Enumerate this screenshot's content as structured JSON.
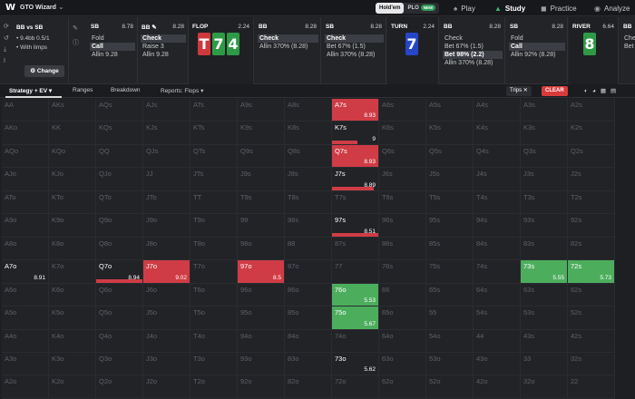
{
  "app": {
    "logo": "W",
    "brand": "GTO Wizard",
    "mode": [
      "Hold'em",
      "PLO"
    ],
    "mode_badge": "NEW",
    "nav": [
      {
        "label": "Play",
        "icon": "spade-icon"
      },
      {
        "label": "Study",
        "icon": "graduation-cap-icon"
      },
      {
        "label": "Practice",
        "icon": "gamepad-icon"
      },
      {
        "label": "Analyze",
        "icon": "robot-icon"
      }
    ]
  },
  "game": {
    "title": "BB vs SB",
    "stack_line": "• 9.4bb 0.5/1",
    "limps_line": "• With limps",
    "change_label": "Change"
  },
  "actions": [
    {
      "pos": "SB",
      "stack": "8.78",
      "items": [
        "Fold",
        "Call",
        "Allin 9.28"
      ],
      "selected": 1
    },
    {
      "pos": "BB",
      "stack": "8.28",
      "items": [
        "Check",
        "Raise 3",
        "Allin 9.28"
      ],
      "selected": 0
    },
    {
      "pos": "FLOP",
      "stack": "2.24",
      "board": [
        "T",
        "7",
        "4"
      ],
      "colors": [
        "#d0383c",
        "#2f9a46",
        "#2f9a46"
      ]
    },
    {
      "pos": "BB",
      "stack": "8.28",
      "items": [
        "Check",
        "Allin 370% (8.28)"
      ],
      "selected": 0
    },
    {
      "pos": "SB",
      "stack": "8.28",
      "items": [
        "Check",
        "Bet 67% (1.5)",
        "Allin 370% (8.28)"
      ],
      "selected": 0
    },
    {
      "pos": "TURN",
      "stack": "2.24",
      "board": [
        "7"
      ],
      "colors": [
        "#2546c8"
      ]
    },
    {
      "pos": "BB",
      "stack": "8.28",
      "items": [
        "Check",
        "Bet 67% (1.5)",
        "Bet 98% (2.2)",
        "Allin 370% (8.28)"
      ],
      "selected": 2
    },
    {
      "pos": "SB",
      "stack": "8.28",
      "items": [
        "Fold",
        "Call",
        "Allin 92% (8.28)"
      ],
      "selected": 1
    },
    {
      "pos": "RIVER",
      "stack": "6.64",
      "board": [
        "8"
      ],
      "colors": [
        "#2f9a46"
      ]
    },
    {
      "pos": "BB",
      "stack": "",
      "items": [
        "Chec",
        "Bet"
      ],
      "selected": -1
    }
  ],
  "subnav": {
    "tabs": [
      "Strategy + EV",
      "Ranges",
      "Breakdown",
      "Reports: Flops"
    ],
    "trips": "Trips",
    "clear": "CLEAR"
  },
  "grid": {
    "rows": [
      [
        "AA",
        "AKs",
        "AQs",
        "AJs",
        "ATs",
        "A9s",
        "A8s",
        "A7s",
        "A6s",
        "A5s",
        "A4s",
        "A3s",
        "A2s"
      ],
      [
        "AKo",
        "KK",
        "KQs",
        "KJs",
        "KTs",
        "K9s",
        "K8s",
        "K7s",
        "K6s",
        "K5s",
        "K4s",
        "K3s",
        "K2s"
      ],
      [
        "AQo",
        "KQo",
        "QQ",
        "QJs",
        "QTs",
        "Q9s",
        "Q8s",
        "Q7s",
        "Q6s",
        "Q5s",
        "Q4s",
        "Q3s",
        "Q2s"
      ],
      [
        "AJo",
        "KJo",
        "QJo",
        "JJ",
        "JTs",
        "J9s",
        "J8s",
        "J7s",
        "J6s",
        "J5s",
        "J4s",
        "J3s",
        "J2s"
      ],
      [
        "ATo",
        "KTo",
        "QTo",
        "JTo",
        "TT",
        "T9s",
        "T8s",
        "T7s",
        "T6s",
        "T5s",
        "T4s",
        "T3s",
        "T2s"
      ],
      [
        "A9o",
        "K9o",
        "Q9o",
        "J9o",
        "T9o",
        "99",
        "98s",
        "97s",
        "96s",
        "95s",
        "94s",
        "93s",
        "92s"
      ],
      [
        "A8o",
        "K8o",
        "Q8o",
        "J8o",
        "T8o",
        "98o",
        "88",
        "87s",
        "86s",
        "85s",
        "84s",
        "83s",
        "82s"
      ],
      [
        "A7o",
        "K7o",
        "Q7o",
        "J7o",
        "T7o",
        "97o",
        "87o",
        "77",
        "76s",
        "75s",
        "74s",
        "73s",
        "72s"
      ],
      [
        "A6o",
        "K6o",
        "Q6o",
        "J6o",
        "T6o",
        "96o",
        "86o",
        "76o",
        "66",
        "65s",
        "64s",
        "63s",
        "62s"
      ],
      [
        "A5o",
        "K5o",
        "Q5o",
        "J5o",
        "T5o",
        "95o",
        "85o",
        "75o",
        "65o",
        "55",
        "54s",
        "53s",
        "52s"
      ],
      [
        "A4o",
        "K4o",
        "Q4o",
        "J4o",
        "T4o",
        "94o",
        "84o",
        "74o",
        "64o",
        "54o",
        "44",
        "43s",
        "42s"
      ],
      [
        "A3o",
        "K3o",
        "Q3o",
        "J3o",
        "T3o",
        "93o",
        "83o",
        "73o",
        "63o",
        "53o",
        "43o",
        "33",
        "32s"
      ],
      [
        "A2o",
        "K2o",
        "Q2o",
        "J2o",
        "T2o",
        "92o",
        "82o",
        "72o",
        "62o",
        "52o",
        "42o",
        "32o",
        "22"
      ]
    ],
    "highlights": [
      {
        "r": 0,
        "c": 7,
        "type": "red",
        "fill": 1,
        "ev": "8.93"
      },
      {
        "r": 1,
        "c": 7,
        "type": "bar",
        "fill": 0.55,
        "ev": "9"
      },
      {
        "r": 2,
        "c": 7,
        "type": "red",
        "fill": 1,
        "ev": "8.93"
      },
      {
        "r": 3,
        "c": 7,
        "type": "bar",
        "fill": 0.9,
        "ev": "8.89"
      },
      {
        "r": 5,
        "c": 7,
        "type": "bar",
        "fill": 1,
        "ev": "8.51"
      },
      {
        "r": 7,
        "c": 0,
        "type": "plain",
        "fill": 0,
        "ev": "8.91"
      },
      {
        "r": 7,
        "c": 2,
        "type": "bar",
        "fill": 1,
        "ev": "8.94"
      },
      {
        "r": 7,
        "c": 3,
        "type": "red",
        "fill": 1,
        "ev": "9.02"
      },
      {
        "r": 7,
        "c": 5,
        "type": "red",
        "fill": 1,
        "ev": "8.5"
      },
      {
        "r": 7,
        "c": 11,
        "type": "green",
        "fill": 1,
        "ev": "5.55"
      },
      {
        "r": 7,
        "c": 12,
        "type": "green",
        "fill": 1,
        "ev": "5.73"
      },
      {
        "r": 8,
        "c": 7,
        "type": "green",
        "fill": 1,
        "ev": "5.53"
      },
      {
        "r": 9,
        "c": 7,
        "type": "green",
        "fill": 1,
        "ev": "5.67"
      },
      {
        "r": 11,
        "c": 7,
        "type": "plain",
        "fill": 0,
        "ev": "5.62"
      }
    ]
  }
}
